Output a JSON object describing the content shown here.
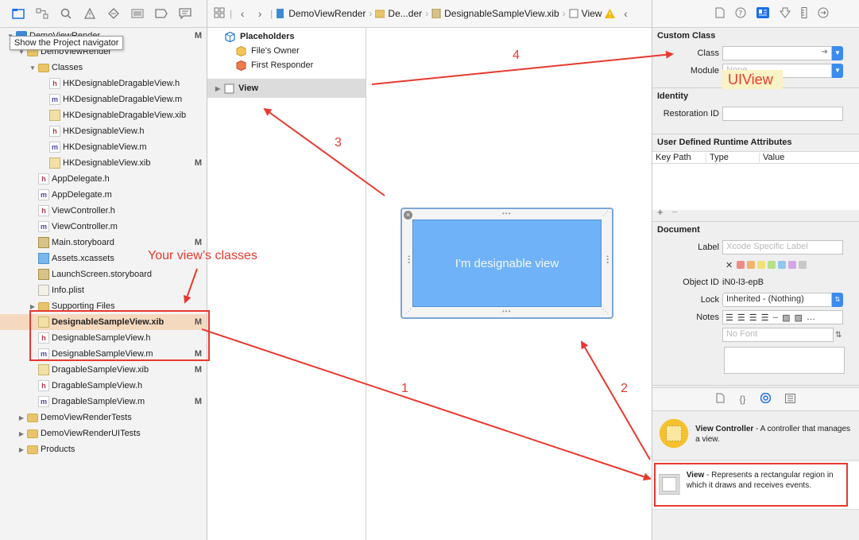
{
  "tooltip": "Show the Project navigator",
  "navigator": {
    "rows": [
      {
        "name": "DemoViewRender",
        "icon": "proj",
        "indent": 0,
        "tri": "▼",
        "status": "M"
      },
      {
        "name": "DemoViewRender",
        "icon": "folder",
        "indent": 1,
        "tri": "▼",
        "status": ""
      },
      {
        "name": "Classes",
        "icon": "folder",
        "indent": 2,
        "tri": "▼",
        "status": ""
      },
      {
        "name": "HKDesignableDragableView.h",
        "icon": "h",
        "indent": 3,
        "tri": "",
        "status": ""
      },
      {
        "name": "HKDesignableDragableView.m",
        "icon": "m",
        "indent": 3,
        "tri": "",
        "status": ""
      },
      {
        "name": "HKDesignableDragableView.xib",
        "icon": "xib",
        "indent": 3,
        "tri": "",
        "status": ""
      },
      {
        "name": "HKDesignableView.h",
        "icon": "h",
        "indent": 3,
        "tri": "",
        "status": ""
      },
      {
        "name": "HKDesignableView.m",
        "icon": "m",
        "indent": 3,
        "tri": "",
        "status": ""
      },
      {
        "name": "HKDesignableView.xib",
        "icon": "xib",
        "indent": 3,
        "tri": "",
        "status": "M"
      },
      {
        "name": "AppDelegate.h",
        "icon": "h",
        "indent": 2,
        "tri": "",
        "status": ""
      },
      {
        "name": "AppDelegate.m",
        "icon": "m",
        "indent": 2,
        "tri": "",
        "status": ""
      },
      {
        "name": "ViewController.h",
        "icon": "h",
        "indent": 2,
        "tri": "",
        "status": ""
      },
      {
        "name": "ViewController.m",
        "icon": "m",
        "indent": 2,
        "tri": "",
        "status": ""
      },
      {
        "name": "Main.storyboard",
        "icon": "sb",
        "indent": 2,
        "tri": "",
        "status": "M"
      },
      {
        "name": "Assets.xcassets",
        "icon": "assets",
        "indent": 2,
        "tri": "",
        "status": ""
      },
      {
        "name": "LaunchScreen.storyboard",
        "icon": "sb",
        "indent": 2,
        "tri": "",
        "status": ""
      },
      {
        "name": "Info.plist",
        "icon": "plist",
        "indent": 2,
        "tri": "",
        "status": ""
      },
      {
        "name": "Supporting Files",
        "icon": "folder",
        "indent": 2,
        "tri": "▶",
        "status": ""
      },
      {
        "name": "DesignableSampleView.xib",
        "icon": "xib",
        "indent": 2,
        "tri": "",
        "status": "M",
        "selected": true
      },
      {
        "name": "DesignableSampleView.h",
        "icon": "h",
        "indent": 2,
        "tri": "",
        "status": ""
      },
      {
        "name": "DesignableSampleView.m",
        "icon": "m",
        "indent": 2,
        "tri": "",
        "status": "M"
      },
      {
        "name": "DragableSampleView.xib",
        "icon": "xib",
        "indent": 2,
        "tri": "",
        "status": "M"
      },
      {
        "name": "DragableSampleView.h",
        "icon": "h",
        "indent": 2,
        "tri": "",
        "status": ""
      },
      {
        "name": "DragableSampleView.m",
        "icon": "m",
        "indent": 2,
        "tri": "",
        "status": "M"
      },
      {
        "name": "DemoViewRenderTests",
        "icon": "folder",
        "indent": 1,
        "tri": "▶",
        "status": ""
      },
      {
        "name": "DemoViewRenderUITests",
        "icon": "folder",
        "indent": 1,
        "tri": "▶",
        "status": ""
      },
      {
        "name": "Products",
        "icon": "folder",
        "indent": 1,
        "tri": "▶",
        "status": ""
      }
    ]
  },
  "jumpbar": {
    "project": "DemoViewRender",
    "folder": "De...der",
    "file": "DesignableSampleView.xib",
    "item": "View"
  },
  "outline": {
    "placeholders": "Placeholders",
    "files_owner": "File's Owner",
    "first_responder": "First Responder",
    "view": "View"
  },
  "canvas": {
    "view_text": "I'm designable view"
  },
  "inspector": {
    "custom_class": {
      "title": "Custom Class",
      "class_label": "Class",
      "class_value": "UIView",
      "module_label": "Module",
      "module_placeholder": "None"
    },
    "identity": {
      "title": "Identity",
      "restoration_label": "Restoration ID"
    },
    "runtime": {
      "title": "User Defined Runtime Attributes",
      "col_keypath": "Key Path",
      "col_type": "Type",
      "col_value": "Value"
    },
    "document": {
      "title": "Document",
      "label_label": "Label",
      "label_placeholder": "Xcode Specific Label",
      "objectid_label": "Object ID",
      "objectid_value": "iN0-l3-epB",
      "lock_label": "Lock",
      "lock_value": "Inherited - (Nothing)",
      "notes_label": "Notes",
      "font_placeholder": "No Font"
    },
    "swatch_colors": [
      "#f08a8a",
      "#f2b36b",
      "#f1e17a",
      "#b6e08a",
      "#8ec7f0",
      "#d3a6e8",
      "#c8c8c8"
    ]
  },
  "library": {
    "vc_title": "View Controller",
    "vc_desc": " - A controller that manages a view.",
    "view_title": "View",
    "view_desc": " - Represents a rectangular region in which it draws and receives events."
  },
  "annotations": {
    "classes_note": "Your view’s classes",
    "step1": "1",
    "step2": "2",
    "step3": "3",
    "step4": "4",
    "color": "#e8392f"
  }
}
